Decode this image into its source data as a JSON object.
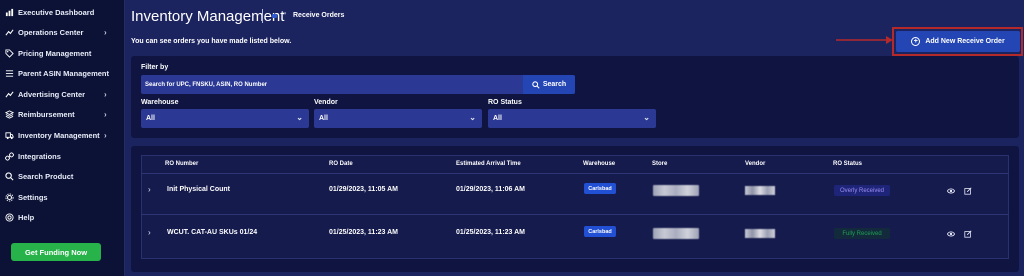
{
  "sidebar": {
    "items": [
      {
        "label": "Executive Dashboard",
        "icon": "chart-icon",
        "chevron": false
      },
      {
        "label": "Operations Center",
        "icon": "trend-icon",
        "chevron": true
      },
      {
        "label": "Pricing Management",
        "icon": "tag-icon",
        "chevron": false
      },
      {
        "label": "Parent ASIN Management",
        "icon": "list-icon",
        "chevron": false
      },
      {
        "label": "Advertising Center",
        "icon": "trend-icon",
        "chevron": true
      },
      {
        "label": "Reimbursement",
        "icon": "layers-icon",
        "chevron": true
      },
      {
        "label": "Inventory Management",
        "icon": "truck-icon",
        "chevron": true
      },
      {
        "label": "Integrations",
        "icon": "link-icon",
        "chevron": false
      },
      {
        "label": "Search Product",
        "icon": "search-icon",
        "chevron": false
      },
      {
        "label": "Settings",
        "icon": "gear-icon",
        "chevron": false
      },
      {
        "label": "Help",
        "icon": "help-icon",
        "chevron": false
      }
    ],
    "funding_button": "Get Funding Now",
    "chevron_glyph": "›"
  },
  "header": {
    "title": "Inventory Management",
    "breadcrumb_arrow": "»",
    "breadcrumb": "Receive Orders",
    "subtitle": "You can see orders you have made listed below.",
    "add_button": "Add New Receive Order"
  },
  "filter": {
    "label": "Filter by",
    "search_placeholder": "Search for UPC, FNSKU, ASIN, RO Number",
    "search_button": "Search",
    "warehouse": {
      "label": "Warehouse",
      "value": "All"
    },
    "vendor": {
      "label": "Vendor",
      "value": "All"
    },
    "ro_status": {
      "label": "RO Status",
      "value": "All"
    }
  },
  "table": {
    "columns": [
      "RO Number",
      "RO Date",
      "Estimated Arrival Time",
      "Warehouse",
      "Store",
      "Vendor",
      "RO Status"
    ],
    "rows": [
      {
        "ro_number": "Init Physical Count",
        "ro_date": "01/29/2023, 11:05 AM",
        "eta": "01/29/2023, 11:06 AM",
        "warehouse": "Carlsbad",
        "status": "Overly Received"
      },
      {
        "ro_number": "WCUT. CAT-AU SKUs 01/24",
        "ro_date": "01/25/2023, 11:23 AM",
        "eta": "01/25/2023, 11:23 AM",
        "warehouse": "Carlsbad",
        "status": "Fully Received"
      }
    ]
  },
  "colors": {
    "sidebar_bg": "#0c1236",
    "page_bg": "#1c2460",
    "accent": "#2446b4",
    "funding_green": "#27b24a",
    "highlight_red": "#b42a2a"
  }
}
